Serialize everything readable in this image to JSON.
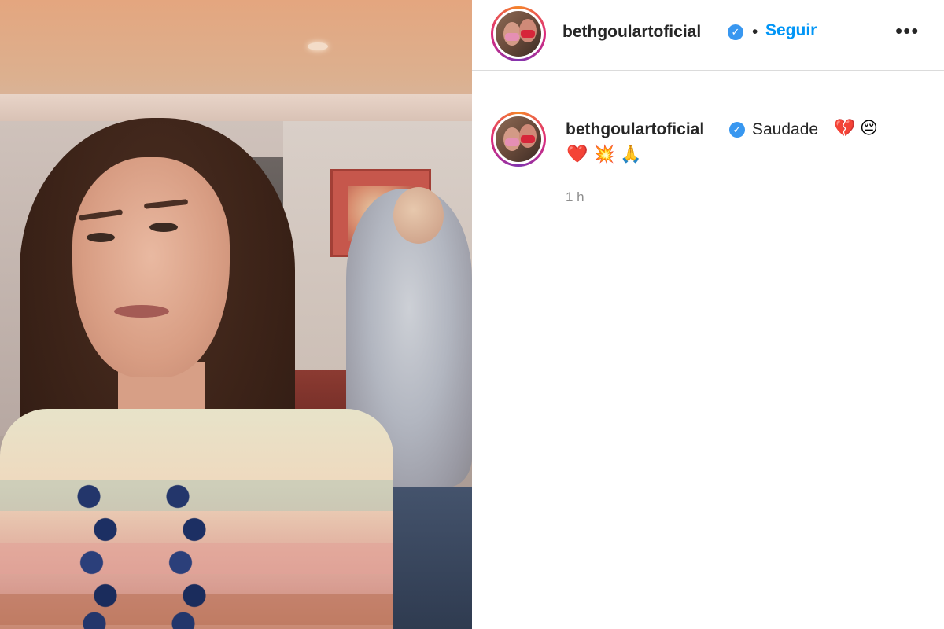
{
  "post": {
    "username": "bethgoulartoficial",
    "verified_badge": "✓",
    "separator": "•",
    "follow_label": "Seguir",
    "more_label": "•••"
  },
  "caption": {
    "username": "bethgoulartoficial",
    "text": "Saudade",
    "emojis": [
      "💔",
      "😔",
      "❤️",
      "💥",
      "🙏"
    ],
    "timestamp": "1 h"
  },
  "icons": {
    "verified": "verified-badge-icon",
    "more": "more-options-icon"
  },
  "colors": {
    "follow": "#0095f6",
    "verified": "#3897f0",
    "text": "#262626",
    "muted": "#8e8e8e"
  }
}
